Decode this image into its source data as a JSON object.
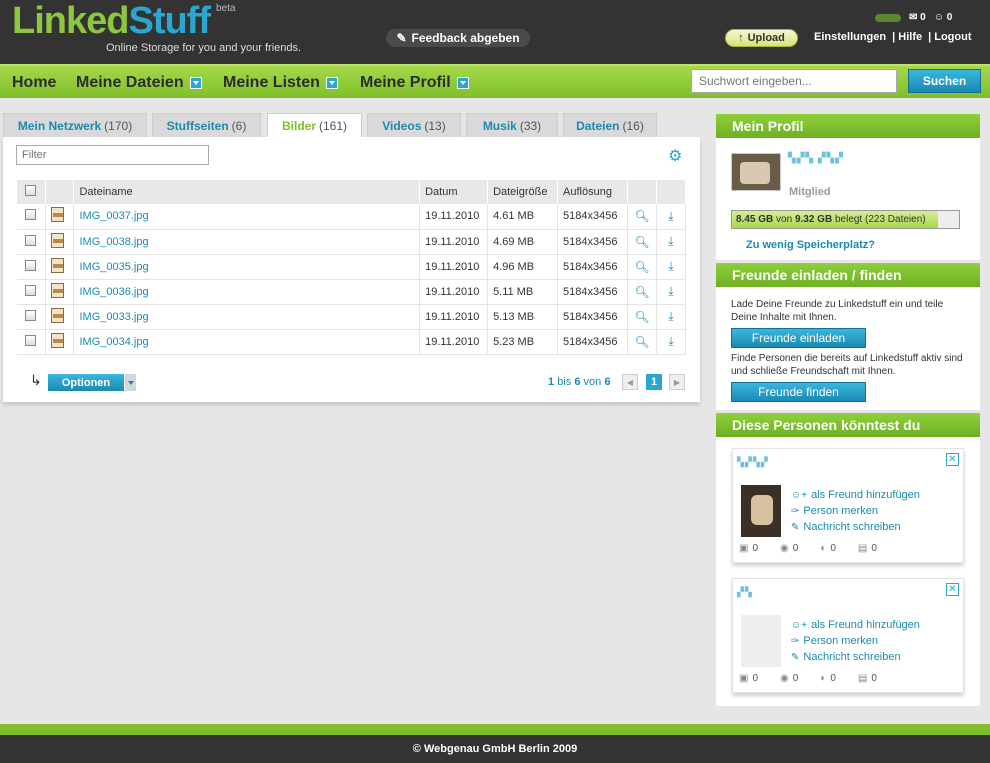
{
  "header": {
    "logo_a": "Linked",
    "logo_b": "Stuff",
    "beta": "beta",
    "tagline": "Online Storage for you and your friends.",
    "feedback": "Feedback abgeben",
    "upload": "Upload",
    "links": [
      "Einstellungen",
      "| Hilfe",
      "| Logout"
    ],
    "mail_count": "0",
    "user_count": "0"
  },
  "nav": {
    "items": [
      {
        "label": "Home"
      },
      {
        "label": "Meine Dateien"
      },
      {
        "label": "Meine Listen"
      },
      {
        "label": "Meine Profil"
      }
    ],
    "search_placeholder": "Suchwort eingeben...",
    "search_btn": "Suchen"
  },
  "tabs": [
    {
      "label": "Mein Netzwerk",
      "count": "(170)"
    },
    {
      "label": "Stuffseiten",
      "count": "(6)"
    },
    {
      "label": "Bilder",
      "count": "(161)"
    },
    {
      "label": "Videos",
      "count": "(13)"
    },
    {
      "label": "Musik",
      "count": "(33)"
    },
    {
      "label": "Dateien",
      "count": "(16)"
    }
  ],
  "filter_placeholder": "Filter",
  "table": {
    "headers": [
      "Dateiname",
      "Datum",
      "Dateigröße",
      "Auflösung"
    ],
    "rows": [
      {
        "name": "IMG_0037.jpg",
        "date": "19.11.2010",
        "size": "4.61 MB",
        "res": "5184x3456"
      },
      {
        "name": "IMG_0038.jpg",
        "date": "19.11.2010",
        "size": "4.69 MB",
        "res": "5184x3456"
      },
      {
        "name": "IMG_0035.jpg",
        "date": "19.11.2010",
        "size": "4.96 MB",
        "res": "5184x3456"
      },
      {
        "name": "IMG_0036.jpg",
        "date": "19.11.2010",
        "size": "5.11 MB",
        "res": "5184x3456"
      },
      {
        "name": "IMG_0033.jpg",
        "date": "19.11.2010",
        "size": "5.13 MB",
        "res": "5184x3456"
      },
      {
        "name": "IMG_0034.jpg",
        "date": "19.11.2010",
        "size": "5.23 MB",
        "res": "5184x3456"
      }
    ]
  },
  "options_btn": "Optionen",
  "pagination": {
    "from": "1",
    "bis": "bis",
    "to": "6",
    "von": "von",
    "total": "6",
    "current": "1"
  },
  "profile": {
    "title": "Mein Profil",
    "role": "Mitglied",
    "used": "8.45 GB",
    "von": "von",
    "quota": "9.32 GB",
    "belegt": "belegt (223 Dateien)",
    "used_fraction": 0.907,
    "need_more": "Zu wenig Speicherplatz?"
  },
  "invite": {
    "title": "Freunde einladen / finden",
    "text1": "Lade Deine Freunde zu Linkedstuff ein und teile Deine Inhalte mit Ihnen.",
    "btn1": "Freunde einladen",
    "text2": "Finde Personen die bereits auf Linkedstuff aktiv sind und schließe Freundschaft mit Ihnen.",
    "btn2": "Freunde finden"
  },
  "suggest": {
    "title": "Diese Personen könntest du",
    "close": "✕",
    "actions": [
      "als Freund hinzufügen",
      "Person merken",
      "Nachricht schreiben"
    ],
    "stats": [
      "0",
      "0",
      "0",
      "0"
    ]
  },
  "footer": "© Webgenau GmbH Berlin 2009"
}
